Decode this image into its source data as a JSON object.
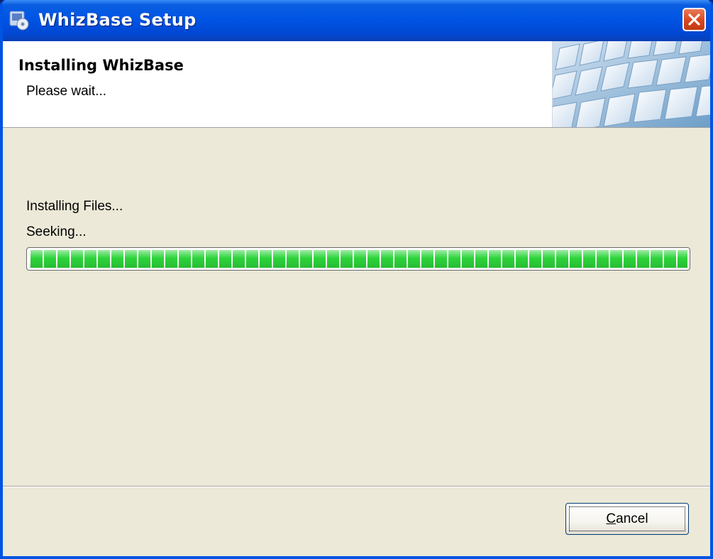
{
  "window": {
    "title": "WhizBase Setup",
    "title_icon": "setup-installer-icon",
    "close_icon": "close-icon"
  },
  "header": {
    "title": "Installing WhizBase",
    "subtitle": "Please wait...",
    "image": "keyboard-keys-banner"
  },
  "content": {
    "status_line1": "Installing Files...",
    "status_line2": "Seeking...",
    "progress": 1.0
  },
  "buttons": {
    "cancel_label": "Cancel",
    "cancel_mnemonic": "C",
    "cancel_rest": "ancel"
  },
  "colors": {
    "titlebar": "#0055e5",
    "progress_fill": "#2ed43c",
    "close_button": "#d8461f",
    "dialog_bg": "#ece9d8"
  }
}
